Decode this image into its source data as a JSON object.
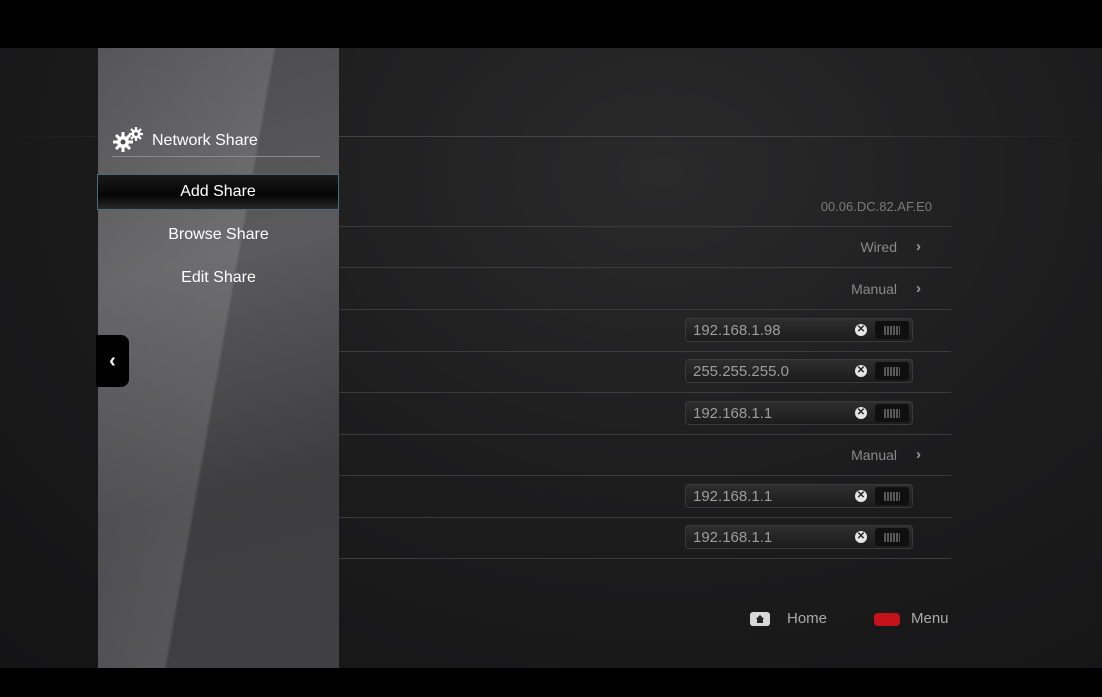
{
  "sidebar": {
    "title": "Network Share",
    "items": [
      {
        "label": "Add Share",
        "active": true
      },
      {
        "label": "Browse Share",
        "active": false
      },
      {
        "label": "Edit Share",
        "active": false
      }
    ]
  },
  "settings": {
    "mac_address": "00.06.DC.82.AF.E0",
    "connection_type": "Wired",
    "ip_mode": "Manual",
    "ip_address": "192.168.1.98",
    "subnet_mask": "255.255.255.0",
    "gateway": "192.168.1.1",
    "dns_mode": "Manual",
    "dns_primary": "192.168.1.1",
    "dns_secondary": "192.168.1.1"
  },
  "footer": {
    "home_label": "Home",
    "menu_label": "Menu"
  },
  "icons": {
    "chevron": "chevron-right-icon",
    "back": "chevron-left-icon",
    "clear": "clear-icon",
    "keyboard": "keyboard-icon"
  },
  "colors": {
    "menu_button_red": "#c4121a"
  }
}
